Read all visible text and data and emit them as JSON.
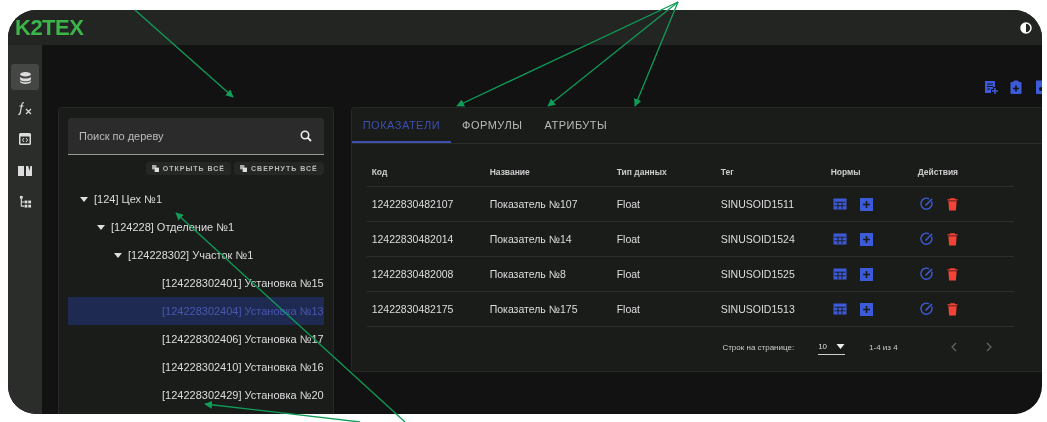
{
  "header": {
    "logo": "K2TEX"
  },
  "rail": [
    {
      "kind": "database",
      "selected": true
    },
    {
      "kind": "formula",
      "selected": false
    },
    {
      "kind": "code",
      "selected": false
    },
    {
      "kind": "book",
      "selected": false
    },
    {
      "kind": "tree",
      "selected": false
    }
  ],
  "tree_panel": {
    "search": {
      "placeholder": "Поиск по дереву"
    },
    "buttons": [
      "ОТКРЫТЬ ВСЁ",
      "СВЕРНУТЬ ВСЁ"
    ],
    "tree": [
      {
        "label": "[124] Цех №1",
        "expanded": true,
        "selected": false,
        "children": [
          {
            "label": "[124228] Отделение №1",
            "expanded": true,
            "selected": false,
            "children": [
              {
                "label": "[124228302] Участок №1",
                "expanded": true,
                "selected": false,
                "children": [
                  {
                    "label": "[124228302401] Установка №15",
                    "selected": false
                  },
                  {
                    "label": "[124228302404] Установка №13",
                    "selected": true
                  },
                  {
                    "label": "[124228302406] Установка №17",
                    "selected": false
                  },
                  {
                    "label": "[124228302410] Установка №16",
                    "selected": false
                  },
                  {
                    "label": "[124228302429] Установка №20",
                    "selected": false
                  }
                ]
              }
            ]
          }
        ]
      }
    ]
  },
  "detail_panel": {
    "tabs": [
      {
        "label": "ПОКАЗАТЕЛИ",
        "selected": true
      },
      {
        "label": "ФОРМУЛЫ",
        "selected": false
      },
      {
        "label": "АТРИБУТЫ",
        "selected": false
      }
    ],
    "table": {
      "columns": [
        "Код",
        "Название",
        "Тип данных",
        "Тег",
        "Нормы",
        "Действия"
      ],
      "rows": [
        [
          "12422830482107",
          "Показатель №107",
          "Float",
          "SINUSOID1511"
        ],
        [
          "12422830482014",
          "Показатель №14",
          "Float",
          "SINUSOID1524"
        ],
        [
          "12422830482008",
          "Показатель №8",
          "Float",
          "SINUSOID1525"
        ],
        [
          "12422830482175",
          "Показатель №175",
          "Float",
          "SINUSOID1513"
        ]
      ]
    },
    "pagination": {
      "rows_label": "Строк на странице:",
      "rows_per_page": "10",
      "range": "1-4 из 4"
    }
  }
}
